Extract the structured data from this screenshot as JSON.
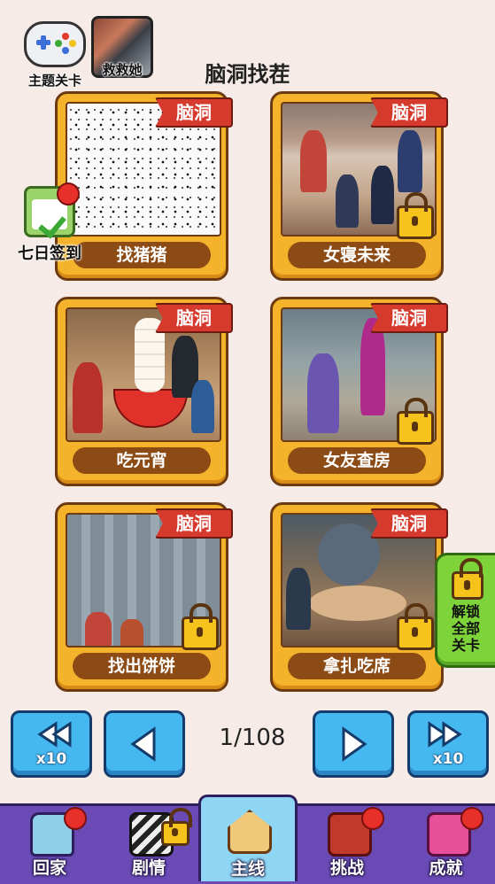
{
  "header": {
    "title": "脑洞找茬",
    "theme_label": "主题关卡",
    "rescue_label": "救救她"
  },
  "checkin": {
    "label": "七日签到"
  },
  "cards": [
    {
      "name": "找猪猪",
      "tag": "脑洞",
      "locked": false
    },
    {
      "name": "女寝未来",
      "tag": "脑洞",
      "locked": true
    },
    {
      "name": "吃元宵",
      "tag": "脑洞",
      "locked": false
    },
    {
      "name": "女友查房",
      "tag": "脑洞",
      "locked": true
    },
    {
      "name": "找出饼饼",
      "tag": "脑洞",
      "locked": true
    },
    {
      "name": "拿扎吃席",
      "tag": "脑洞",
      "locked": true
    }
  ],
  "unlock_all": {
    "line1": "解锁",
    "line2": "全部",
    "line3": "关卡"
  },
  "pager": {
    "page": "1/108",
    "back10": "x10",
    "forward10": "x10"
  },
  "nav": [
    {
      "label": "回家",
      "icon": "sofa-icon"
    },
    {
      "label": "剧情",
      "icon": "clapperboard-icon"
    },
    {
      "label": "主线",
      "icon": "house-icon"
    },
    {
      "label": "挑战",
      "icon": "crossed-swords-icon"
    },
    {
      "label": "成就",
      "icon": "crown-icon"
    }
  ],
  "colors": {
    "background": "#f6ebe6",
    "card": "#f4b32a",
    "ribbon": "#d63a2d",
    "pager_button": "#46b8f0",
    "nav": "#6a4bb5",
    "unlock_button": "#7ed33a"
  }
}
